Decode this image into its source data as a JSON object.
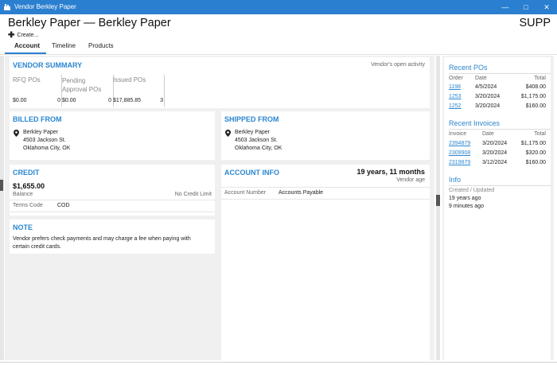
{
  "window": {
    "title": "Vendor Berkley Paper"
  },
  "header": {
    "title": "Berkley Paper — Berkley Paper",
    "code": "SUPP",
    "create_label": "Create..."
  },
  "tabs": [
    {
      "label": "Account"
    },
    {
      "label": "Timeline"
    },
    {
      "label": "Products"
    }
  ],
  "summary": {
    "title": "VENDOR SUMMARY",
    "note": "Vendor's open activity",
    "columns": [
      {
        "label": "RFQ POs",
        "label2": "",
        "amount": "$0.00",
        "count": "0"
      },
      {
        "label": "Pending",
        "label2": "Approval POs",
        "amount": "$0.00",
        "count": "0"
      },
      {
        "label": "Issued POs",
        "label2": "",
        "amount": "$17,885.85",
        "count": "3"
      }
    ]
  },
  "billed_from": {
    "title": "BILLED FROM",
    "name": "Berkley Paper",
    "street": "4503 Jackson St.",
    "city": "Oklahoma City, OK"
  },
  "shipped_from": {
    "title": "SHIPPED FROM",
    "name": "Berkley Paper",
    "street": "4503 Jackson St.",
    "city": "Oklahoma City, OK"
  },
  "credit": {
    "title": "CREDIT",
    "balance": "$1,655.00",
    "balance_label": "Balance",
    "limit": "No Credit Limit",
    "terms_label": "Terms Code",
    "terms_value": "COD"
  },
  "account_info": {
    "title": "ACCOUNT INFO",
    "age": "19 years, 11 months",
    "age_label": "Vendor age",
    "number_label": "Account Number",
    "number_value": "Accounts Payable"
  },
  "note": {
    "title": "NOTE",
    "line1": "Vendor prefers check payments and may charge a fee when paying with",
    "line2": "certain credit cards."
  },
  "recent_pos": {
    "title": "Recent POs",
    "headers": [
      "Order",
      "Date",
      "Total"
    ],
    "rows": [
      [
        "1198",
        "4/5/2024",
        "$408.00"
      ],
      [
        "1253",
        "3/20/2024",
        "$1,175.00"
      ],
      [
        "1252",
        "3/20/2024",
        "$160.00"
      ]
    ]
  },
  "recent_invoices": {
    "title": "Recent Invoices",
    "headers": [
      "Invoice",
      "Date",
      "Total"
    ],
    "rows": [
      [
        "2394879",
        "3/20/2024",
        "$1,175.00"
      ],
      [
        "2309908",
        "3/20/2024",
        "$320.00"
      ],
      [
        "2319879",
        "3/12/2024",
        "$160.00"
      ]
    ]
  },
  "info": {
    "title": "Info",
    "label": "Created / Updated",
    "created": "19 years ago",
    "updated": "9 minutes ago"
  }
}
